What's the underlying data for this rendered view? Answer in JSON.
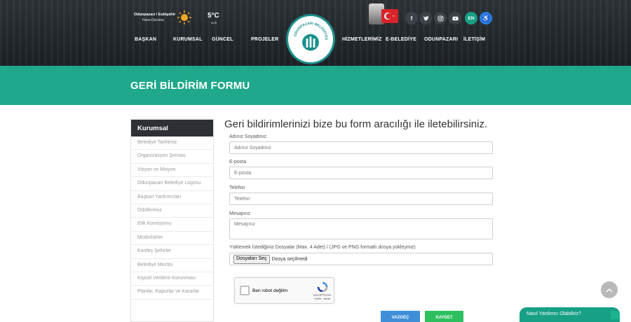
{
  "header": {
    "weather_location": "Odunpazarı / Eskişehir",
    "weather_label": "Hava Durumu",
    "temperature": "5°C",
    "weather_desc": "açık",
    "nav_left": [
      "BAŞKAN",
      "KURUMSAL",
      "GÜNCEL",
      "PROJELER"
    ],
    "nav_right": [
      "HİZMETLERİMİZ",
      "E-BELEDİYE",
      "ODUNPAZARI",
      "İLETİŞİM"
    ],
    "logo_text": "ODUNPAZARI BELEDİYESİ",
    "social": [
      "f",
      "t",
      "ig",
      "yt"
    ],
    "lang": "EN"
  },
  "page": {
    "title": "GERİ BİLDİRİM FORMU"
  },
  "sidebar": {
    "title": "Kurumsal",
    "items": [
      "Belediye Tarihimiz",
      "Organizasyon Şeması",
      "Vizyon ve Misyon",
      "Odunpazarı Belediye Logosu",
      "Başkan Yardımcıları",
      "Ödüllerimiz",
      "Etik Komisyonu",
      "Müdürlükler",
      "Kardeş Şehirler",
      "Belediye Meclisi",
      "Kişisel Verilerin Korunması",
      "Planlar, Raporlar ve Kararlar"
    ]
  },
  "form": {
    "lead": "Geri bildirimlerinizi bize bu form aracılığı ile iletebilirsiniz.",
    "name_label": "Adınız Soyadınız",
    "name_placeholder": "Adınız Soyadınız",
    "email_label": "E-posta",
    "email_placeholder": "E-posta",
    "phone_label": "Telefon",
    "phone_placeholder": "Telefon",
    "message_label": "Mesajınız",
    "message_placeholder": "Mesajınız",
    "files_label": "Yüklemek İstediğiniz Dosyalar (Max. 4 Adet) / (JPG ve PNG formatlı dosya yükleyiniz)",
    "file_button": "Dosyaları Seç",
    "file_status": "Dosya seçilmedi",
    "captcha_label": "Ben robot değilim",
    "captcha_brand": "reCAPTCHA",
    "captcha_links": "Gizlilik - Şartlar",
    "cancel": "VAZGEÇ",
    "save": "KAYDET"
  },
  "chat": {
    "label": "Nasıl Yardımcı Olabiliriz?"
  },
  "colors": {
    "teal": "#1fa88b",
    "header": "#2e3338",
    "blue": "#3e8fd8",
    "green": "#2dbf5d"
  }
}
